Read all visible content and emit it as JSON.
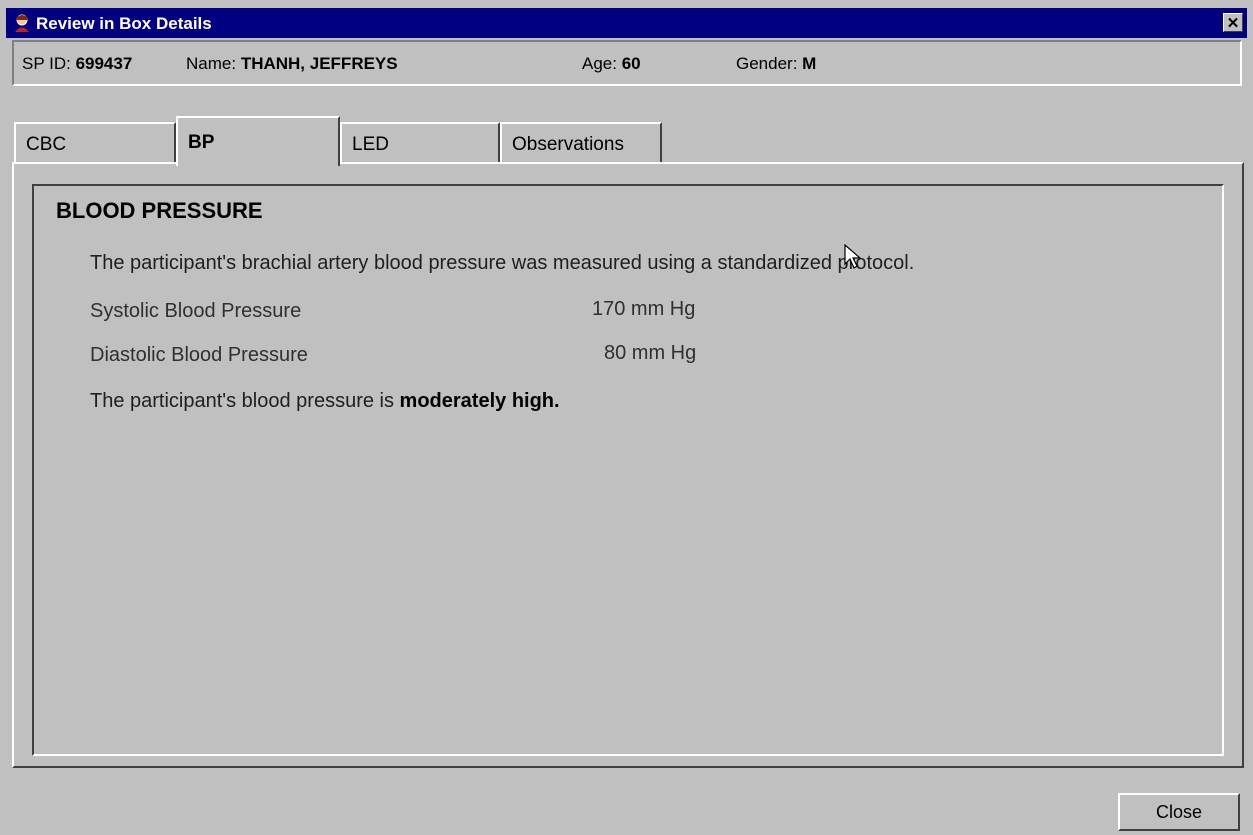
{
  "window": {
    "title": "Review in Box Details",
    "close_glyph": "✕"
  },
  "icons": {
    "app": "person-icon",
    "close": "close-icon",
    "cursor": "mouse-pointer-icon"
  },
  "patient": {
    "spid_label": "SP ID:",
    "spid": "699437",
    "name_label": "Name:",
    "name": "THANH, JEFFREYS",
    "age_label": "Age:",
    "age": "60",
    "gender_label": "Gender:",
    "gender": "M"
  },
  "tabs": [
    {
      "label": "CBC",
      "active": false
    },
    {
      "label": "BP",
      "active": true
    },
    {
      "label": "LED",
      "active": false
    },
    {
      "label": "Observations",
      "active": false
    }
  ],
  "panel": {
    "title": "BLOOD PRESSURE",
    "description": "The participant's brachial artery blood pressure was measured using a standardized protocol.",
    "rows": [
      {
        "label": "Systolic Blood Pressure",
        "value": "170 mm Hg"
      },
      {
        "label": "Diastolic Blood Pressure",
        "value": "80 mm Hg"
      }
    ],
    "status_prefix": "The participant's blood pressure is",
    "status_value": "moderately high."
  },
  "buttons": {
    "close": "Close"
  },
  "colors": {
    "titlebar": "#000080",
    "face": "#c0c0c0"
  }
}
